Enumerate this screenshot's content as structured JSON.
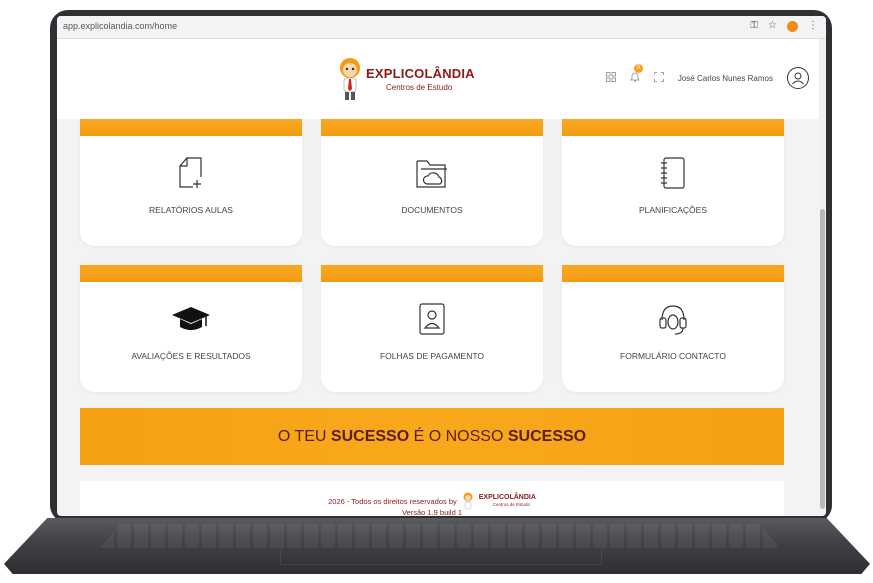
{
  "browser": {
    "url": "app.explicolandia.com/home",
    "icons": [
      "key-icon",
      "star-icon",
      "extension-icon",
      "menu-dots-icon"
    ]
  },
  "header": {
    "logo_title": "EXPLICOLÂNDIA",
    "logo_subtitle": "Centros de Estudo",
    "user_name": "José Carlos Nunes Ramos",
    "notification_count": "0"
  },
  "cards": [
    {
      "label": "RELATÓRIOS AULAS",
      "icon": "new-document-icon"
    },
    {
      "label": "DOCUMENTOS",
      "icon": "cloud-folder-icon"
    },
    {
      "label": "PLANIFICAÇÕES",
      "icon": "notebook-icon"
    },
    {
      "label": "AVALIAÇÕES E RESULTADOS",
      "icon": "graduation-cap-icon"
    },
    {
      "label": "FOLHAS DE PAGAMENTO",
      "icon": "contact-card-icon"
    },
    {
      "label": "FORMULÁRIO CONTACTO",
      "icon": "headset-icon"
    }
  ],
  "banner": {
    "part1": "O TEU ",
    "part2": "SUCESSO",
    "part3": " É O NOSSO ",
    "part4": "SUCESSO"
  },
  "footer": {
    "copyright": "2026 - Todos os direitos reservados by",
    "logo_title": "EXPLICOLÂNDIA",
    "logo_subtitle": "Centros de Estudo",
    "version": "Versão 1.9 build 1"
  },
  "colors": {
    "accent_orange": "#f5a014",
    "brand_red": "#8b1a1a"
  }
}
